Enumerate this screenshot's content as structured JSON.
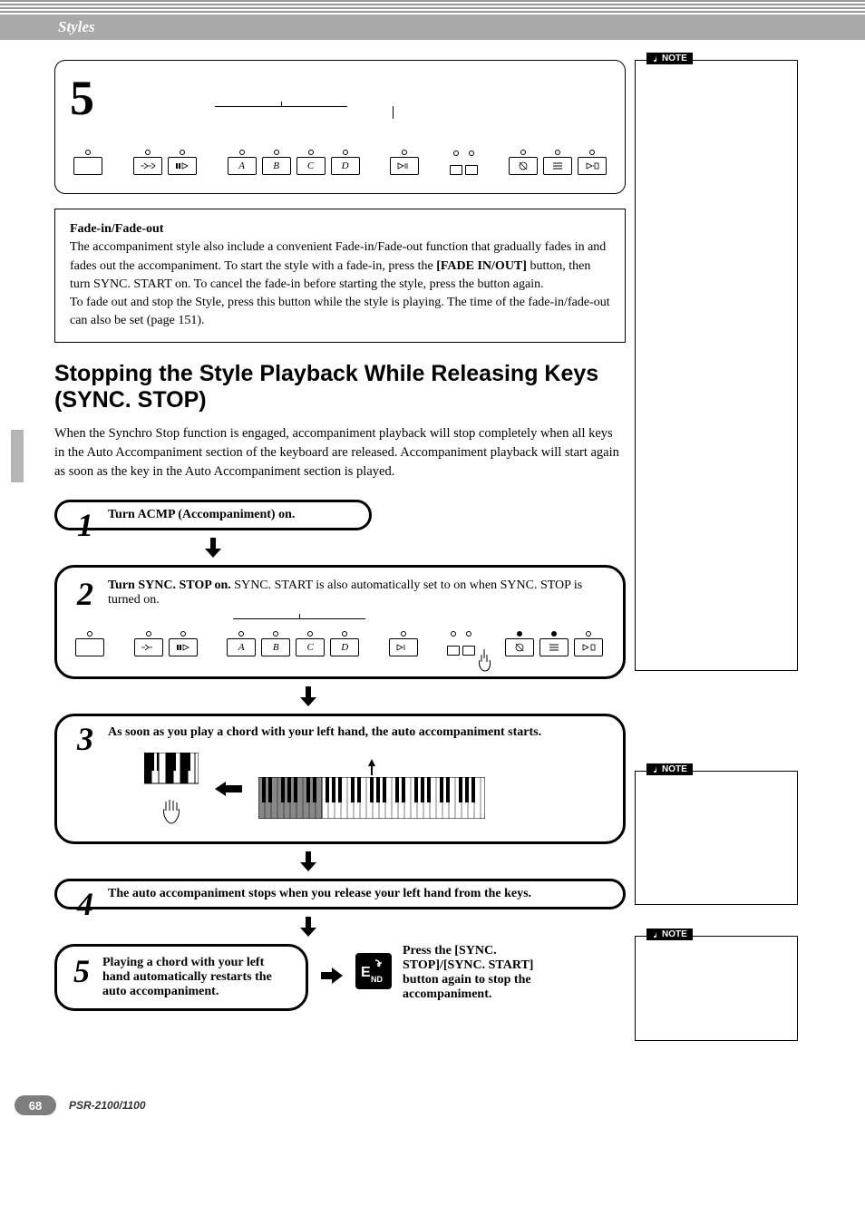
{
  "chapter": "Styles",
  "step5_top_number": "5",
  "fadebox": {
    "title": "Fade-in/Fade-out",
    "p1a": "The accompaniment style also include a convenient Fade-in/Fade-out function that gradually fades in and fades out the accompaniment. To start the style with a fade-in, press the ",
    "p1b": "[FADE IN/OUT]",
    "p1c": " button, then turn SYNC. START on. To cancel the fade-in before starting the style, press the button again.",
    "p2": "To fade out and stop the Style, press this button while the style is playing. The time of the fade-in/fade-out can also be set (page 151)."
  },
  "section": {
    "title": "Stopping the Style Playback While Releasing Keys (SYNC. STOP)",
    "desc": "When the Synchro Stop function is engaged, accompaniment playback will stop completely when all keys in the Auto Accompaniment section of the keyboard are released. Accompaniment playback will start again as soon as the key in the Auto Accompaniment section is played."
  },
  "steps": {
    "s1_num": "1",
    "s1_text": "Turn ACMP (Accompaniment) on.",
    "s2_num": "2",
    "s2_bold": "Turn SYNC. STOP on.",
    "s2_rest": " SYNC. START is also automatically set to on when SYNC. STOP is turned on.",
    "s3_num": "3",
    "s3_text": "As soon as you play a chord with your left hand, the auto accompaniment starts.",
    "s4_num": "4",
    "s4_text": "The auto accompaniment stops when you release your left hand from the keys.",
    "s5_num": "5",
    "s5_text": "Playing a chord with your left hand automatically restarts the auto accompaniment.",
    "end_label": "END",
    "end_text": "Press the [SYNC. STOP]/[SYNC. START] button again to stop the accompaniment."
  },
  "buttons": {
    "a": "A",
    "b": "B",
    "c": "C",
    "d": "D"
  },
  "note_label": "NOTE",
  "page_number": "68",
  "model": "PSR-2100/1100"
}
